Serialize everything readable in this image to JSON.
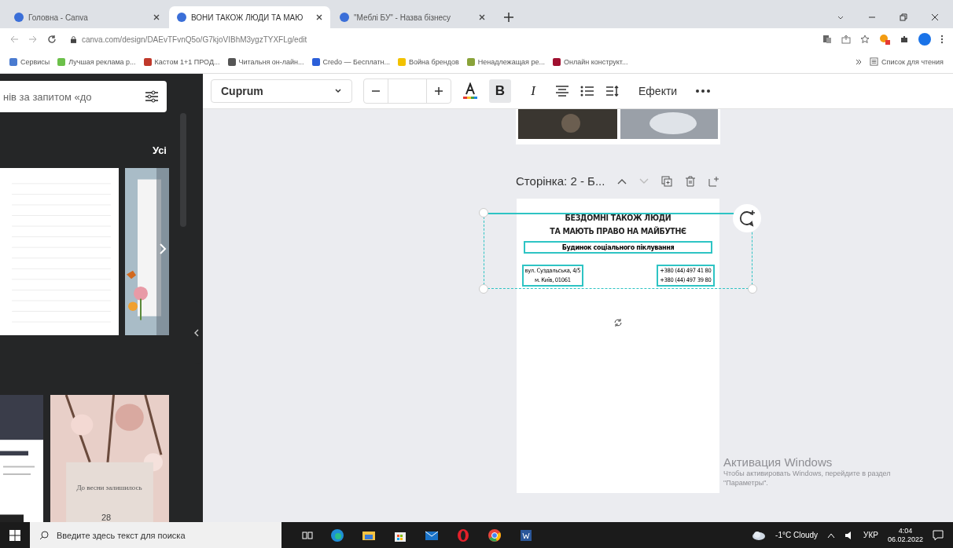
{
  "browser": {
    "tabs": [
      {
        "title": "Головна - Canva",
        "selected": false
      },
      {
        "title": "ВОНИ ТАКОЖ ЛЮДИ ТА МАЮ",
        "selected": true
      },
      {
        "title": "\"Меблі БУ\" - Назва бізнесу",
        "selected": false
      }
    ],
    "url": "canva.com/design/DAEvTFvnQ5o/G7kjoVIBhM3ygzTYXFLg/edit",
    "bookmarks": [
      {
        "label": "Сервисы",
        "color": "#4a7bd0"
      },
      {
        "label": "Лучшая реклама р...",
        "color": "#6cc04a"
      },
      {
        "label": "Кастом 1+1 ПРОД...",
        "color": "#c0392b"
      },
      {
        "label": "Читальня он-лайн...",
        "color": "#555555"
      },
      {
        "label": "Credo — Бесплатн...",
        "color": "#2b5fd9"
      },
      {
        "label": "Война брендов",
        "color": "#f2c200"
      },
      {
        "label": "Ненадлежащая ре...",
        "color": "#8aa33a"
      },
      {
        "label": "Онлайн конструкт...",
        "color": "#a01030"
      }
    ],
    "reading_list": "Список для чтения"
  },
  "side_panel": {
    "search_placeholder": "нів за запитом «до",
    "filter_label": "Усі",
    "template_texts": [
      "До весни залишилось",
      "28"
    ]
  },
  "toolbar": {
    "font": "Cuprum",
    "bold_label": "B",
    "bold_active": true,
    "italic_label": "I",
    "italic_active": false,
    "effects": "Ефекти"
  },
  "page": {
    "header": "Сторінка: 2 - Б...",
    "selected": true,
    "title_lines": [
      "БЕЗДОМНІ ТАКОЖ ЛЮДИ",
      "ТА МАЮТЬ ПРАВО НА МАЙБУТНЄ"
    ],
    "subtitle": "Будинок соціального піклування",
    "address_lines": [
      "вул. Суздальська, 4/5",
      "м. Київ, 01061"
    ],
    "phone_lines": [
      "+380 (44) 497 41 80",
      "+380 (44) 497 39 80"
    ]
  },
  "activation": {
    "title": "Активация Windows",
    "text": "Чтобы активировать Windows, перейдите в раздел \"Параметры\"."
  },
  "taskbar": {
    "search_placeholder": "Введите здесь текст для поиска",
    "weather": "-1°C Cloudy",
    "language": "УКР",
    "time": "4:04",
    "date": "06.02.2022"
  }
}
